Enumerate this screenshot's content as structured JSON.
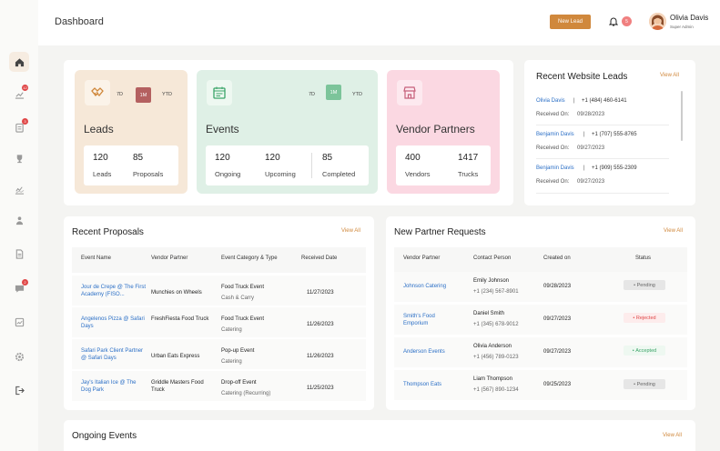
{
  "header": {
    "title": "Dashboard",
    "new_lead_label": "New Lead",
    "notification_count": "5",
    "user_name": "Olivia Davis",
    "user_role": "Super Admin"
  },
  "sidebar": {
    "items": [
      {
        "icon": "home-icon",
        "active": true,
        "badge": ""
      },
      {
        "icon": "chart-icon",
        "active": false,
        "badge": "12"
      },
      {
        "icon": "clipboard-icon",
        "active": false,
        "badge": "3"
      },
      {
        "icon": "trophy-icon",
        "active": false,
        "badge": ""
      },
      {
        "icon": "analytics-icon",
        "active": false,
        "badge": ""
      },
      {
        "icon": "users-icon",
        "active": false,
        "badge": ""
      },
      {
        "icon": "document-icon",
        "active": false,
        "badge": ""
      },
      {
        "icon": "chat-icon",
        "active": false,
        "badge": "2"
      },
      {
        "icon": "report-icon",
        "active": false,
        "badge": ""
      },
      {
        "icon": "settings-icon",
        "active": false,
        "badge": ""
      },
      {
        "icon": "logout-icon",
        "active": false,
        "badge": ""
      }
    ]
  },
  "cards": {
    "leads": {
      "title": "Leads",
      "periods": [
        "7D",
        "1M",
        "YTD"
      ],
      "selected": "1M",
      "stats": [
        {
          "value": "120",
          "label": "Leads"
        },
        {
          "value": "85",
          "label": "Proposals"
        }
      ]
    },
    "events": {
      "title": "Events",
      "periods": [
        "7D",
        "1M",
        "YTD"
      ],
      "selected": "1M",
      "stats": [
        {
          "value": "120",
          "label": "Ongoing"
        },
        {
          "value": "120",
          "label": "Upcoming"
        },
        {
          "value": "85",
          "label": "Completed"
        }
      ]
    },
    "vendors": {
      "title": "Vendor Partners",
      "stats": [
        {
          "value": "400",
          "label": "Vendors"
        },
        {
          "value": "1417",
          "label": "Trucks"
        }
      ]
    }
  },
  "recent_leads": {
    "title": "Recent Website Leads",
    "view_all": "View All",
    "received_prefix": "Received On:",
    "items": [
      {
        "name": "Olivia Davis",
        "phone": "+1 (484) 460-6141",
        "date": "09/28/2023"
      },
      {
        "name": "Benjamin Davis",
        "phone": "+1 (707) 555-8765",
        "date": "09/27/2023"
      },
      {
        "name": "Benjamin Davis",
        "phone": "+1 (909) 555-2309",
        "date": "09/27/2023"
      }
    ]
  },
  "proposals": {
    "title": "Recent Proposals",
    "view_all": "View All",
    "headers": [
      "Event Name",
      "Vendor Partner",
      "Event Category & Type",
      "Received  Date"
    ],
    "rows": [
      {
        "event": "Jour de Crepe @ The First Academy (FISO...",
        "vendor": "Munchies on Wheels",
        "category": "Food Truck Event",
        "type": "Cash & Carry",
        "date": "11/27/2023"
      },
      {
        "event": "Angelenos Pizza @ Safari Days",
        "vendor": "FreshFiesta Food Truck",
        "category": "Food Truck Event",
        "type": "Catering",
        "date": "11/26/2023"
      },
      {
        "event": "Safari Park Client Partner @ Safari Days",
        "vendor": "Urban Eats Express",
        "category": "Pop-up Event",
        "type": "Catering",
        "date": "11/26/2023"
      },
      {
        "event": "Jay's Italian Ice @ The Dog Park",
        "vendor": "Griddle Masters Food Truck",
        "category": "Drop-off Event",
        "type": "Catering (Recurring)",
        "date": "11/25/2023"
      }
    ]
  },
  "partner_requests": {
    "title": "New Partner Requests",
    "view_all": "View All",
    "headers": [
      "Vendor Partner",
      "Contact Person",
      "Created on",
      "Status"
    ],
    "rows": [
      {
        "vendor": "Johnson Catering",
        "contact": "Emily Johnson",
        "phone": "+1 (234) 567-8901",
        "date": "09/28/2023",
        "status": "Pending",
        "status_type": "pending"
      },
      {
        "vendor": "Smith's Food Emporium",
        "contact": "Daniel Smith",
        "phone": "+1 (345) 678-9012",
        "date": "09/27/2023",
        "status": "Rejected",
        "status_type": "rejected"
      },
      {
        "vendor": "Anderson Events",
        "contact": "Olivia Anderson",
        "phone": "+1 (456) 789-0123",
        "date": "09/27/2023",
        "status": "Accepted",
        "status_type": "accepted"
      },
      {
        "vendor": "Thompson Eats",
        "contact": "Liam Thompson",
        "phone": "+1 (567) 890-1234",
        "date": "09/25/2023",
        "status": "Pending",
        "status_type": "pending"
      }
    ]
  },
  "ongoing_events": {
    "title": "Ongoing Events",
    "view_all": "View All"
  },
  "colors": {
    "accent": "#d0883c",
    "leads_card": "#f6e8d8",
    "events_card": "#dff0e6",
    "vendors_card": "#fbd8e2",
    "link": "#2b6fc6"
  }
}
